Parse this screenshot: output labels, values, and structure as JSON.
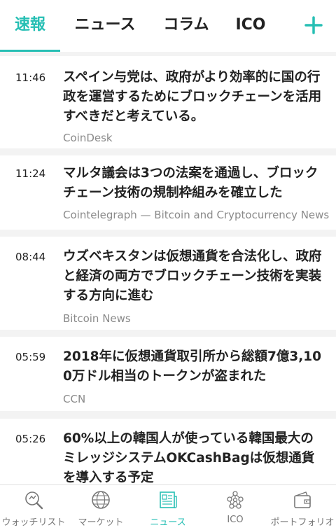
{
  "tabs": [
    "速報",
    "ニュース",
    "コラム",
    "ICO"
  ],
  "add_icon": "plus-icon",
  "accent_color": "#27bfb4",
  "news": [
    {
      "time": "11:46",
      "headline": "スペイン与党は、政府がより効率的に国の行政を運営するためにブロックチェーンを活用すべきだと考えている。",
      "source": "CoinDesk"
    },
    {
      "time": "11:24",
      "headline": "マルタ議会は3つの法案を通過し、ブロックチェーン技術の規制枠組みを確立した",
      "source": "Cointelegraph — Bitcoin and Cryptocurrency News"
    },
    {
      "time": "08:44",
      "headline": "ウズベキスタンは仮想通貨を合法化し、政府と経済の両方でブロックチェーン技術を実装する方向に進む",
      "source": "Bitcoin News"
    },
    {
      "time": "05:59",
      "headline": "2018年に仮想通貨取引所から総額7億3,100万ドル相当のトークンが盗まれた",
      "source": "CCN"
    },
    {
      "time": "05:26",
      "headline": "60%以上の韓国人が使っている韓国最大のミレッジシステムOKCashBagは仮想通貨を導入する予定",
      "source": ""
    }
  ],
  "bottom_nav": [
    {
      "label": "ウォッチリスト",
      "icon": "magnifier-icon"
    },
    {
      "label": "マーケット",
      "icon": "globe-icon"
    },
    {
      "label": "ニュース",
      "icon": "newspaper-icon"
    },
    {
      "label": "ICO",
      "icon": "network-icon"
    },
    {
      "label": "ポートフォリオ",
      "icon": "wallet-icon"
    }
  ]
}
